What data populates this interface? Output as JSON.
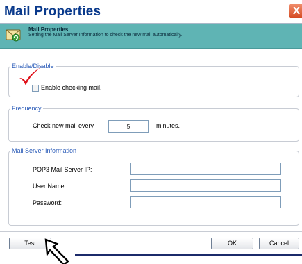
{
  "window": {
    "title": "Mail Properties",
    "close_glyph": "X"
  },
  "header": {
    "title": "Mail Properties",
    "subtitle": "Setting the Mail Server Information to check the new mail automatically.",
    "icon": "mail-envelope-icon"
  },
  "enable_group": {
    "legend": "Enable/Disable",
    "checkbox_label": "Enable checking mail.",
    "checked": false
  },
  "frequency_group": {
    "legend": "Frequency",
    "prefix_label": "Check new mail every",
    "value": "5",
    "suffix_label": "minutes."
  },
  "server_group": {
    "legend": "Mail Server Information",
    "pop3_label": "POP3 Mail Server IP:",
    "pop3_value": "",
    "user_label": "User Name:",
    "user_value": "",
    "password_label": "Password:",
    "password_value": ""
  },
  "buttons": {
    "test": "Test",
    "ok": "OK",
    "cancel": "Cancel"
  },
  "annotations": {
    "checkmark_color": "#e0121b",
    "pointer_icon": "arrow-pointer-icon"
  },
  "colors": {
    "title": "#0a3a8c",
    "header_band": "#5fb4b4",
    "legend": "#2a5bb8"
  }
}
